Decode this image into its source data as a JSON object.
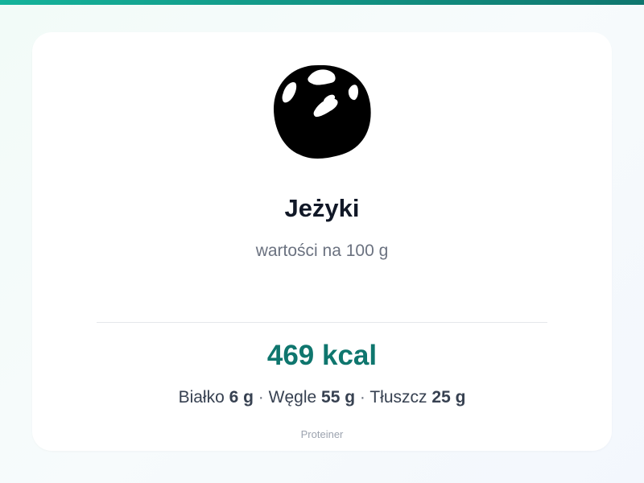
{
  "colors": {
    "accent": "#0f766e",
    "accent_light": "#14b39b",
    "title": "#111827",
    "muted": "#6b7280",
    "footer": "#9ca3af",
    "card_background": "#ffffff"
  },
  "product": {
    "image_icon": "product-photo-icon",
    "name": "Jeżyki",
    "serving_note": "wartości na 100 g",
    "calories": "469 kcal"
  },
  "macros": {
    "separator": "·",
    "protein": {
      "label": "Białko",
      "value": "6 g"
    },
    "carbs": {
      "label": "Węgle",
      "value": "55 g"
    },
    "fat": {
      "label": "Tłuszcz",
      "value": "25 g"
    }
  },
  "footer": {
    "brand": "Proteiner"
  }
}
